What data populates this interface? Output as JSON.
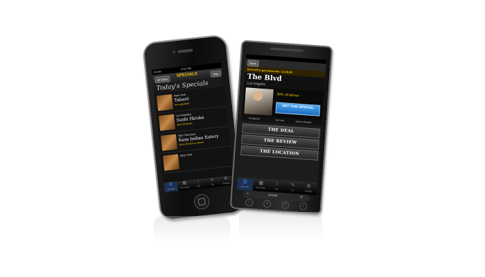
{
  "iphone": {
    "status": {
      "carrier": "Carrier",
      "time": "5:42 PM"
    },
    "nav": {
      "left_button": "All Cities",
      "title": "SPECIALS",
      "right_button": "Map"
    },
    "header_title": "Today's Specials",
    "specials": [
      {
        "city": "New York",
        "name": "Tabaré",
        "deal": "free appetizer"
      },
      {
        "city": "Los Angeles",
        "name": "Sushi Hiroba",
        "deal": "30% off dinner"
      },
      {
        "city": "San Francisco",
        "name": "Kasa Indian Eatery",
        "deal": "30% off lunch or dinner"
      },
      {
        "city": "New York",
        "name": "",
        "deal": ""
      }
    ],
    "tabs": [
      {
        "label": "Specials",
        "icon": "specials-icon"
      },
      {
        "label": "My Codes",
        "icon": "codes-icon"
      },
      {
        "label": "Info",
        "icon": "info-icon"
      },
      {
        "label": "Tip",
        "icon": "tip-icon"
      },
      {
        "label": "Settings",
        "icon": "gear-icon"
      }
    ]
  },
  "android": {
    "back_label": "Back",
    "timer_prefix": "time left to get passcode:",
    "timer_value": "11:45:09",
    "venue": {
      "name": "The Blvd",
      "city": "Los Angeles"
    },
    "offer": "30% off dinner",
    "cta": "GET THIS SPECIAL",
    "social": [
      "FACEBOOK",
      "TWITTER",
      "EMAIL FRIENDS"
    ],
    "sections": [
      "THE DEAL",
      "THE REVIEW",
      "THE LOCATION"
    ],
    "tabs": [
      {
        "label": "Specials",
        "icon": "specials-icon"
      },
      {
        "label": "My Codes",
        "icon": "codes-icon"
      },
      {
        "label": "Info",
        "icon": "info-icon"
      },
      {
        "label": "Tip",
        "icon": "tip-icon"
      },
      {
        "label": "Settings",
        "icon": "gear-icon"
      }
    ],
    "dock": {
      "brand": "sneak",
      "plus": "+"
    }
  },
  "colors": {
    "accent": "#f3c300",
    "active_tab": "#4fa3ff",
    "cta": "#1c6dc0"
  }
}
